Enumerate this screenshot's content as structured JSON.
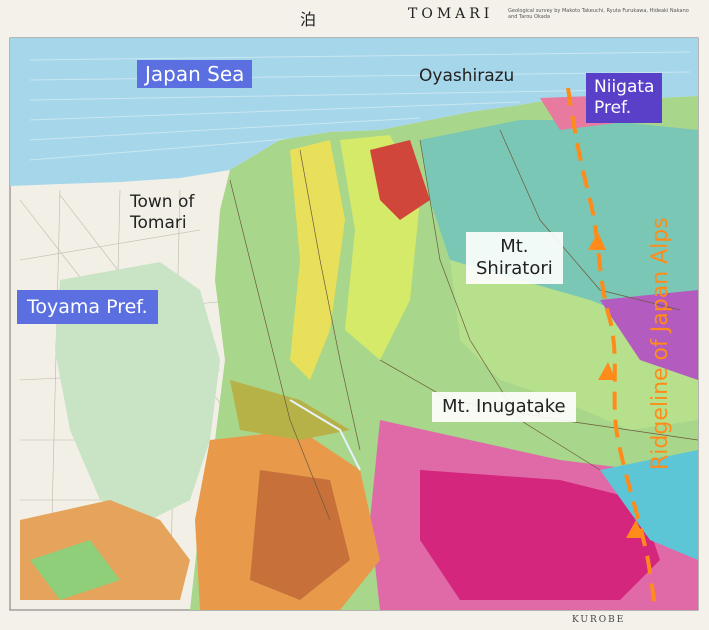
{
  "map": {
    "title_jp": "泊",
    "title_en": "TOMARI",
    "bottom_title": "KUROBE",
    "credit": "Geological survey by Makoto Takeuchi, Ryuta Furukawa, Hideaki Nakano and Tarou Okada",
    "colors": {
      "sea": "#a6d6ea",
      "plain": "#f2efe6",
      "accent_orange": "#ff8c1a",
      "label_blue": "#5b6fe0",
      "label_purple": "#5a3fc8"
    }
  },
  "labels": {
    "japan_sea": "Japan Sea",
    "oyashirazu": "Oyashirazu",
    "niigata_line1": "Niigata",
    "niigata_line2": "Pref.",
    "town_line1": "Town of",
    "town_line2": "Tomari",
    "toyama": "Toyama Pref.",
    "shiratori_line1": "Mt.",
    "shiratori_line2": "Shiratori",
    "inugatake": "Mt. Inugatake",
    "ridgeline": "Ridgeline of Japan Alps"
  }
}
